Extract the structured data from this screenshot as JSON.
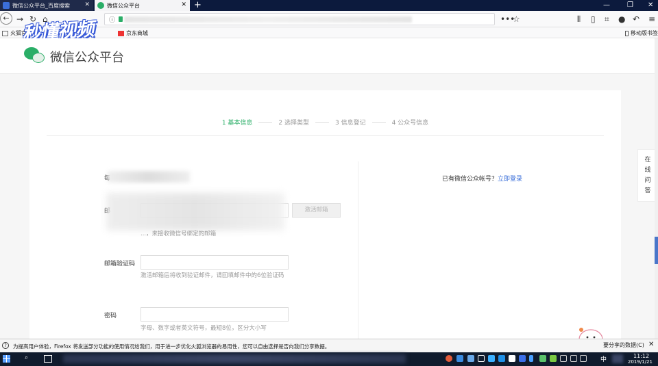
{
  "browser": {
    "tabs": [
      {
        "label": "微信公众平台_百度搜索",
        "close": "✕"
      },
      {
        "label": "微信公众平台",
        "close": "✕"
      }
    ],
    "new_tab": "+",
    "window_controls": [
      "—",
      "❐",
      "✕"
    ],
    "bookmarks": [
      {
        "label": "火狐官"
      },
      {
        "label": "京东商城"
      }
    ],
    "mobile_bookmarks": "移动版书签"
  },
  "watermark": "秒懂视频",
  "site": {
    "title": "微信公众平台"
  },
  "steps": [
    "1 基本信息",
    "2 选择类型",
    "3 信息登记",
    "4 公众号信息"
  ],
  "form": {
    "email_label": "邮",
    "email_row_label_prefix": "每",
    "activate_button": "激活邮箱",
    "email_hint": "...，来接收微信号绑定的邮箱",
    "code_label": "邮箱验证码",
    "code_hint": "激活邮箱后将收到验证邮件，请回填邮件中的6位验证码",
    "password_label": "密码",
    "password_hint": "字母、数字或者英文符号，最短8位，区分大小写"
  },
  "login_prompt": {
    "text": "已有微信公众帐号？",
    "link": "立即登录"
  },
  "side_widget": [
    "在",
    "线",
    "问",
    "答"
  ],
  "notification": {
    "message": "为提高用户体验，Firefox 将发送部分功能的使用情况给我们，用于进一步优化火狐浏览器的易用性，您可以自由选择是否向我们分享数据。",
    "button": "要分享的数据(C)",
    "close": "✕"
  },
  "taskbar": {
    "ime": "中",
    "time": "11:12",
    "date": "2019/1/21"
  },
  "colors": {
    "accent": "#2aae67",
    "link": "#3b6fd9"
  }
}
